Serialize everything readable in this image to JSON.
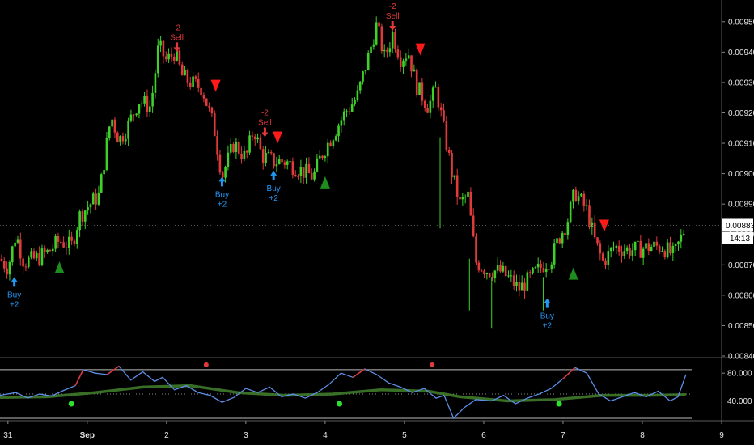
{
  "chart_data": [
    {
      "type": "candlestick",
      "title": "",
      "ylim": [
        0.0084,
        0.00955
      ],
      "y_ticks": [
        "0.00840",
        "0.00850",
        "0.00860",
        "0.00870",
        "0.00880",
        "0.00890",
        "0.00900",
        "0.00910",
        "0.00920",
        "0.00930",
        "0.00940",
        "0.00950"
      ],
      "x_ticks": [
        {
          "label": "31",
          "x": 0.1
        },
        {
          "label": "Sep",
          "x": 1.1
        },
        {
          "label": "2",
          "x": 2.1
        },
        {
          "label": "3",
          "x": 3.1
        },
        {
          "label": "4",
          "x": 4.1
        },
        {
          "label": "5",
          "x": 5.1
        },
        {
          "label": "6",
          "x": 6.1
        },
        {
          "label": "7",
          "x": 7.1
        },
        {
          "label": "8",
          "x": 8.1
        },
        {
          "label": "9",
          "x": 9.1
        }
      ],
      "x_range": [
        0,
        9.1
      ],
      "colors": {
        "up": "#3fd12a",
        "down": "#e03a3a",
        "buy": "#2196f3",
        "sell": "#e03a3a",
        "triangle_up": "#1e8c1e",
        "triangle_down": "#ff1a1a"
      },
      "price_path": [
        [
          0.0,
          0.00872
        ],
        [
          0.1,
          0.00869
        ],
        [
          0.2,
          0.0088
        ],
        [
          0.3,
          0.00871
        ],
        [
          0.45,
          0.00872
        ],
        [
          0.6,
          0.00874
        ],
        [
          0.75,
          0.00878
        ],
        [
          0.9,
          0.00876
        ],
        [
          1.0,
          0.00886
        ],
        [
          1.1,
          0.00889
        ],
        [
          1.25,
          0.00893
        ],
        [
          1.4,
          0.00919
        ],
        [
          1.5,
          0.00911
        ],
        [
          1.6,
          0.00915
        ],
        [
          1.75,
          0.00924
        ],
        [
          1.9,
          0.00922
        ],
        [
          2.0,
          0.00942
        ],
        [
          2.1,
          0.00937
        ],
        [
          2.2,
          0.0094
        ],
        [
          2.3,
          0.00932
        ],
        [
          2.4,
          0.0093
        ],
        [
          2.55,
          0.00928
        ],
        [
          2.7,
          0.00915
        ],
        [
          2.8,
          0.00899
        ],
        [
          2.95,
          0.0091
        ],
        [
          3.1,
          0.00905
        ],
        [
          3.2,
          0.00915
        ],
        [
          3.3,
          0.00906
        ],
        [
          3.45,
          0.00904
        ],
        [
          3.6,
          0.00904
        ],
        [
          3.8,
          0.00901
        ],
        [
          3.95,
          0.00899
        ],
        [
          4.05,
          0.00906
        ],
        [
          4.2,
          0.00913
        ],
        [
          4.35,
          0.0092
        ],
        [
          4.5,
          0.00925
        ],
        [
          4.65,
          0.00939
        ],
        [
          4.75,
          0.00949
        ],
        [
          4.85,
          0.00938
        ],
        [
          4.95,
          0.00946
        ],
        [
          5.05,
          0.00938
        ],
        [
          5.15,
          0.0094
        ],
        [
          5.25,
          0.00929
        ],
        [
          5.4,
          0.00922
        ],
        [
          5.5,
          0.00928
        ],
        [
          5.6,
          0.00914
        ],
        [
          5.7,
          0.009
        ],
        [
          5.8,
          0.0089
        ],
        [
          5.9,
          0.00893
        ],
        [
          6.0,
          0.00871
        ],
        [
          6.15,
          0.00868
        ],
        [
          6.3,
          0.00868
        ],
        [
          6.4,
          0.00866
        ],
        [
          6.55,
          0.00862
        ],
        [
          6.7,
          0.00866
        ],
        [
          6.85,
          0.0087
        ],
        [
          6.95,
          0.00872
        ],
        [
          7.05,
          0.00879
        ],
        [
          7.15,
          0.00884
        ],
        [
          7.25,
          0.00894
        ],
        [
          7.4,
          0.00888
        ],
        [
          7.5,
          0.00878
        ],
        [
          7.6,
          0.00871
        ],
        [
          7.75,
          0.00876
        ],
        [
          7.9,
          0.00875
        ],
        [
          8.05,
          0.00875
        ],
        [
          8.2,
          0.00876
        ],
        [
          8.35,
          0.00876
        ],
        [
          8.5,
          0.00873
        ],
        [
          8.65,
          0.00883
        ]
      ],
      "buy_signals": [
        {
          "x": 0.18,
          "price": 0.00866,
          "label": "Buy",
          "value": "+2"
        },
        {
          "x": 2.8,
          "price": 0.00899,
          "label": "Buy",
          "value": "+2"
        },
        {
          "x": 3.45,
          "price": 0.00901,
          "label": "Buy",
          "value": "+2"
        },
        {
          "x": 6.9,
          "price": 0.00859,
          "label": "Buy",
          "value": "+2"
        }
      ],
      "sell_signals": [
        {
          "x": 2.23,
          "price": 0.0094,
          "label": "Sell",
          "value": "-2"
        },
        {
          "x": 3.34,
          "price": 0.00912,
          "label": "Sell",
          "value": "-2"
        },
        {
          "x": 4.95,
          "price": 0.00947,
          "label": "Sell",
          "value": "-2"
        }
      ],
      "triangles_up": [
        {
          "x": 0.75,
          "price": 0.00869
        },
        {
          "x": 4.1,
          "price": 0.00897
        },
        {
          "x": 7.23,
          "price": 0.00867
        }
      ],
      "triangles_down": [
        {
          "x": 2.72,
          "price": 0.00929
        },
        {
          "x": 3.5,
          "price": 0.00912
        },
        {
          "x": 5.3,
          "price": 0.00941
        },
        {
          "x": 7.62,
          "price": 0.00883
        }
      ],
      "last_price": "0.00883",
      "countdown": "14:13"
    },
    {
      "type": "line",
      "title": "",
      "ylim": [
        15,
        100
      ],
      "y_ticks": [
        "80.000",
        "40.000"
      ],
      "bands": [
        85,
        50,
        15
      ],
      "series": [
        {
          "color": "#5b8ee6",
          "values": [
            [
              0.0,
              48
            ],
            [
              0.2,
              52
            ],
            [
              0.35,
              44
            ],
            [
              0.5,
              50
            ],
            [
              0.65,
              47
            ],
            [
              0.8,
              55
            ],
            [
              0.95,
              62
            ],
            [
              1.05,
              85
            ],
            [
              1.2,
              80
            ],
            [
              1.35,
              78
            ],
            [
              1.5,
              90
            ],
            [
              1.65,
              70
            ],
            [
              1.8,
              82
            ],
            [
              1.95,
              68
            ],
            [
              2.05,
              74
            ],
            [
              2.2,
              56
            ],
            [
              2.35,
              62
            ],
            [
              2.5,
              52
            ],
            [
              2.65,
              48
            ],
            [
              2.8,
              38
            ],
            [
              2.95,
              45
            ],
            [
              3.1,
              58
            ],
            [
              3.25,
              52
            ],
            [
              3.4,
              60
            ],
            [
              3.55,
              46
            ],
            [
              3.7,
              50
            ],
            [
              3.85,
              44
            ],
            [
              4.0,
              52
            ],
            [
              4.15,
              64
            ],
            [
              4.3,
              80
            ],
            [
              4.45,
              74
            ],
            [
              4.6,
              86
            ],
            [
              4.75,
              78
            ],
            [
              4.9,
              66
            ],
            [
              5.05,
              60
            ],
            [
              5.2,
              52
            ],
            [
              5.35,
              58
            ],
            [
              5.5,
              44
            ],
            [
              5.6,
              48
            ],
            [
              5.72,
              15
            ],
            [
              5.85,
              30
            ],
            [
              6.0,
              42
            ],
            [
              6.2,
              40
            ],
            [
              6.35,
              48
            ],
            [
              6.5,
              36
            ],
            [
              6.65,
              44
            ],
            [
              6.8,
              50
            ],
            [
              6.95,
              58
            ],
            [
              7.1,
              72
            ],
            [
              7.25,
              88
            ],
            [
              7.4,
              80
            ],
            [
              7.55,
              50
            ],
            [
              7.7,
              40
            ],
            [
              7.85,
              46
            ],
            [
              8.0,
              52
            ],
            [
              8.15,
              46
            ],
            [
              8.3,
              54
            ],
            [
              8.45,
              40
            ],
            [
              8.55,
              46
            ],
            [
              8.65,
              78
            ]
          ]
        },
        {
          "color": "#3f7a2a",
          "values": [
            [
              0.0,
              45
            ],
            [
              0.6,
              46
            ],
            [
              1.2,
              52
            ],
            [
              1.8,
              60
            ],
            [
              2.4,
              62
            ],
            [
              3.0,
              52
            ],
            [
              3.6,
              48
            ],
            [
              4.2,
              50
            ],
            [
              4.8,
              56
            ],
            [
              5.4,
              54
            ],
            [
              5.8,
              46
            ],
            [
              6.4,
              40
            ],
            [
              7.0,
              42
            ],
            [
              7.6,
              48
            ],
            [
              8.2,
              48
            ],
            [
              8.65,
              49
            ]
          ]
        }
      ],
      "overbought_dots": [
        {
          "x": 2.6,
          "value": 92
        },
        {
          "x": 5.45,
          "value": 92
        }
      ],
      "oversold_dots": [
        {
          "x": 0.9,
          "value": 36
        },
        {
          "x": 4.28,
          "value": 36
        },
        {
          "x": 7.05,
          "value": 36
        }
      ]
    }
  ]
}
